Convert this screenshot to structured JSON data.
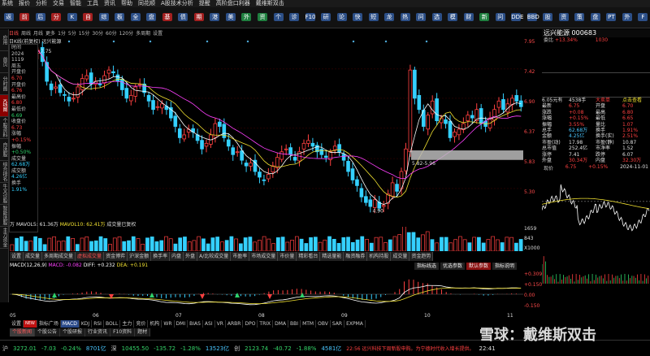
{
  "menu": [
    "系统",
    "报价",
    "分析",
    "交易",
    "智能",
    "工具",
    "资讯",
    "帮助",
    "同花顺",
    "A股技术分析",
    "提醒",
    "高阶盘口利器",
    "戴维斯双击"
  ],
  "toolbar": [
    "返",
    "前",
    "后",
    "分",
    "K",
    "自",
    "综",
    "板",
    "全",
    "盘",
    "基",
    "债",
    "期",
    "港",
    "美",
    "外",
    "资",
    "个",
    "诊",
    "F10",
    "研",
    "论",
    "快",
    "短",
    "龙",
    "热",
    "问",
    "选",
    "模",
    "财",
    "新",
    "问",
    "DDE",
    "BBD",
    "股",
    "资",
    "策",
    "盘",
    "PT",
    "外",
    "F"
  ],
  "leftnav": [
    "应用",
    "首页",
    "分时图",
    "K线图",
    "个股资料",
    "自选股",
    "综合排名",
    "牛叉诊股",
    "智能选股",
    "主力资金"
  ],
  "leftnav_active": 3,
  "periods": [
    "日线",
    "周线",
    "月线",
    "更多",
    "1分",
    "5分",
    "15分",
    "30分",
    "60分",
    "120分",
    "多周期",
    "设置"
  ],
  "periods_active": 0,
  "title_line": "日K线(前复权)  远兴能源",
  "info": {
    "time_label": "时间",
    "date1": "2024",
    "date2": "1119",
    "weekday": "周五",
    "up_label": "开盘价",
    "up_val": "6.70",
    "open_label": "开盘价",
    "open_val": "6.76",
    "high_label": "最高价",
    "high_val": "6.80",
    "low_label": "最低价",
    "low_val": "6.69",
    "close_label": "收盘价",
    "close_val": "6.73",
    "chg_label": "涨幅",
    "chg_val": "+0.15%",
    "amp_label": "振幅",
    "amp_val": "+0.50%",
    "vol_label": "成交量",
    "vol_val": "62.68万",
    "amt_label": "成交额",
    "amt_val": "4.26亿",
    "turn_label": "换手",
    "turn_val": "1.91%"
  },
  "price_annotations": {
    "peak": "7.75",
    "low": "4.90",
    "range": "5.82-5.96"
  },
  "right_scale": [
    "7.95",
    "7.42",
    "6.90",
    "6.37",
    "5.83",
    "5.30"
  ],
  "vol_line": {
    "prefix": "万",
    "ma5": "MAVOL5: 61.36万",
    "ma10": "MAVOL10: 62.41万",
    "note": "成交量已复权"
  },
  "vol_scale": [
    "1659",
    "843",
    "X1000"
  ],
  "ind_tabs": [
    "设置",
    "成交量",
    "多周期成交量",
    "虚拟成交量",
    "资金博弈",
    "沪深金额",
    "换手率",
    "内盘",
    "外盘",
    "A/比较成交量",
    "市盈率",
    "市场成交量",
    "市价量",
    "精彩看台",
    "精选量能",
    "融资融券",
    "机构持股",
    "成交量",
    "资金趋势"
  ],
  "ind_tabs_red": [
    3
  ],
  "macd_line": {
    "title": "MACD(12,26,9)",
    "macd": "MACD: -0.082",
    "diff": "DIFF: +0.232",
    "dea": "DEA: +0.191"
  },
  "macd_scale": [
    "+0.309",
    "+0.150",
    "0.00",
    "-0.150"
  ],
  "macd_buttons": [
    "指标线选",
    "优选参数",
    "默认参数",
    "指标说明"
  ],
  "date_axis": [
    "05",
    "06",
    "07",
    "08",
    "09",
    "10",
    "11"
  ],
  "bottom_tabs": [
    "设置",
    "NEW",
    "指标广场",
    "MACD",
    "KDJ",
    "RSI",
    "BOLL",
    "主力",
    "竞价",
    "机构",
    "WR",
    "DMI",
    "BIAS",
    "ASI",
    "VR",
    "ARBR",
    "DPO",
    "TRIX",
    "DMA",
    "BBI",
    "MTM",
    "OBV",
    "SAR",
    "EXPMA"
  ],
  "bottom_tabs_active": 3,
  "bottom_tabs2": [
    "个股新闻",
    "个股公告",
    "个股研报",
    "行业资讯",
    "F10资料",
    "题材"
  ],
  "bottom_tabs2_active": 0,
  "status": {
    "sh_label": "沪",
    "sh_idx": "3272.01",
    "sh_chg": "-7.03",
    "sh_pct": "-0.24%",
    "sh_amt": "8701亿",
    "sz_label": "深",
    "sz_idx": "10455.50",
    "sz_chg": "-135.72",
    "sz_pct": "-1.28%",
    "sz_amt": "13523亿",
    "cy_label": "创",
    "cy_idx": "2123.74",
    "cy_chg": "-40.72",
    "cy_pct": "-1.88%",
    "cy_amt": "4581亿",
    "news": "22:56  远兴科技下周新股申购。为宁德时代收入增长提供。",
    "clock": "22:41"
  },
  "quote": {
    "name": "远兴能源 000683",
    "pct": "+13.34%",
    "diff": "1030",
    "asks": [
      {
        "l": "5",
        "p": "6.80",
        "q": "2939"
      },
      {
        "l": "4",
        "p": "6.79",
        "q": "1848"
      },
      {
        "l": "3",
        "p": "6.78",
        "q": "2006"
      },
      {
        "l": "2",
        "p": "6.77",
        "q": "894"
      },
      {
        "l": "1",
        "p": "6.76",
        "q": "3"
      }
    ],
    "bids": [
      {
        "l": "1",
        "p": "6.75",
        "q": "1045"
      },
      {
        "l": "2",
        "p": "6.74",
        "q": "105"
      },
      {
        "l": "3",
        "p": "6.73",
        "q": "1193"
      },
      {
        "l": "4",
        "p": "6.72",
        "q": "3499"
      }
    ],
    "ask_label": "卖",
    "bid_label": "买",
    "diff_label": "委比"
  },
  "stats": {
    "head": [
      "6.05元有",
      "4538手",
      "大卖单",
      "点击查看"
    ],
    "rows": [
      [
        "最新",
        "6.75",
        "开盘",
        "6.70"
      ],
      [
        "涨跌",
        "+0.08",
        "最高",
        "6.80"
      ],
      [
        "涨幅",
        "+0.15%",
        "最低",
        "6.65"
      ],
      [
        "振幅",
        "3.55%",
        "量比",
        "1.07"
      ],
      [
        "总手",
        "62.68万",
        "换手",
        "1.91%"
      ],
      [
        "金额",
        "4.25亿",
        "换手(实)",
        "2.51%"
      ],
      [
        "市盈(动)",
        "17.98",
        "市盈(静)",
        "10.87"
      ],
      [
        "总市值",
        "252.4亿",
        "市净率",
        "1.52"
      ],
      [
        "涨停",
        "7.41",
        "跌停",
        "6.07"
      ],
      [
        "外盘",
        "30.34万",
        "内盘",
        "32.30万"
      ]
    ]
  },
  "intraday": {
    "label": "现价",
    "price": "6.75",
    "pct": "+0.15%",
    "date": "2024-11-01"
  },
  "watermark": "雪球：戴维斯双击",
  "colors": {
    "up": "#ff4040",
    "down": "#34d0ff",
    "ma5": "#ffffff",
    "ma10": "#f0e030",
    "bg": "#000000"
  }
}
